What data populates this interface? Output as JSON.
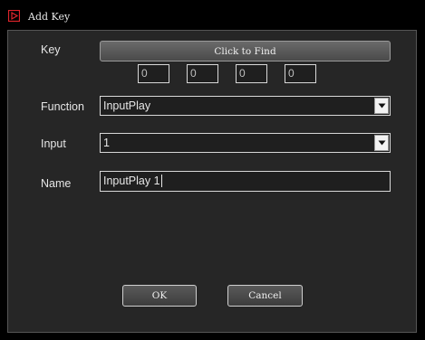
{
  "window": {
    "title": "Add Key",
    "icon": "app-logo-icon"
  },
  "key": {
    "label": "Key",
    "find_button": "Click to Find",
    "values": [
      "0",
      "0",
      "0",
      "0"
    ]
  },
  "function": {
    "label": "Function",
    "value": "InputPlay"
  },
  "input": {
    "label": "Input",
    "value": "1"
  },
  "name": {
    "label": "Name",
    "value": "InputPlay 1"
  },
  "buttons": {
    "ok": "OK",
    "cancel": "Cancel"
  },
  "colors": {
    "logo_accent": "#e0242b",
    "panel_bg": "#262626"
  }
}
